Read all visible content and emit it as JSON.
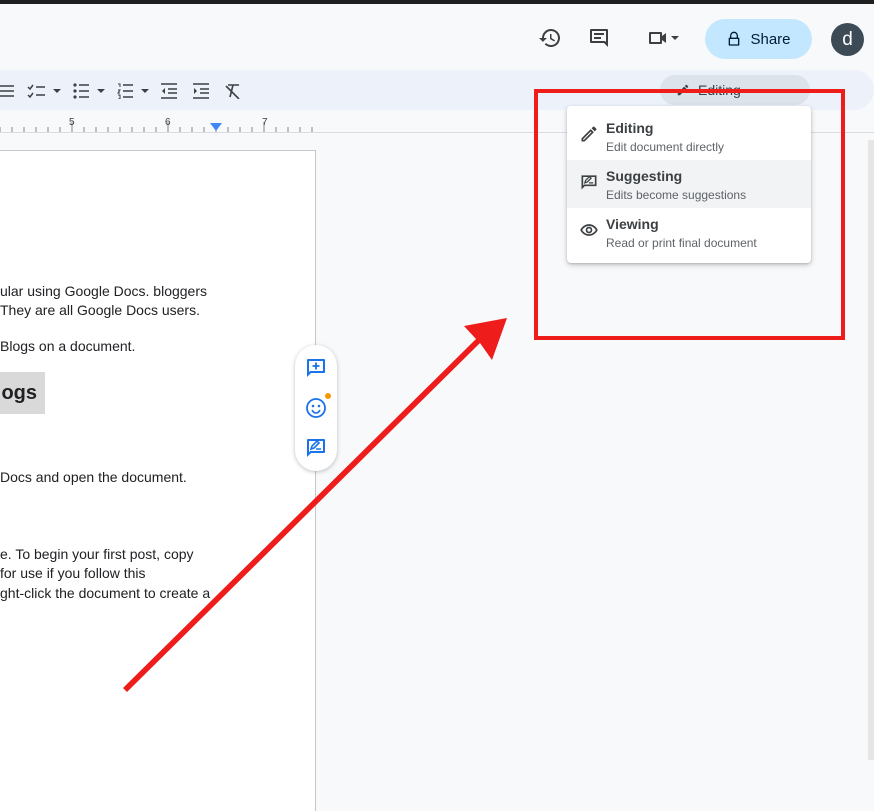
{
  "header": {
    "share_label": "Share",
    "avatar_letter": "d"
  },
  "toolbar": {
    "mode_label": "Editing"
  },
  "ruler": {
    "numbers": [
      "5",
      "6",
      "7"
    ]
  },
  "document": {
    "lines": [
      "ular using Google Docs. bloggers",
      "They are all Google Docs users.",
      " Blogs on a document.",
      "Docs and open the document.",
      "e. To begin your first post, copy",
      " for use if you follow this",
      "ght-click the document to create a"
    ],
    "heading": "ogs"
  },
  "mode_menu": {
    "items": [
      {
        "title": "Editing",
        "subtitle": "Edit document directly"
      },
      {
        "title": "Suggesting",
        "subtitle": "Edits become suggestions"
      },
      {
        "title": "Viewing",
        "subtitle": "Read or print final document"
      }
    ]
  },
  "colors": {
    "annotation": "#ef1c1c",
    "share_bg": "#c2e7ff",
    "accent": "#1a73e8"
  }
}
